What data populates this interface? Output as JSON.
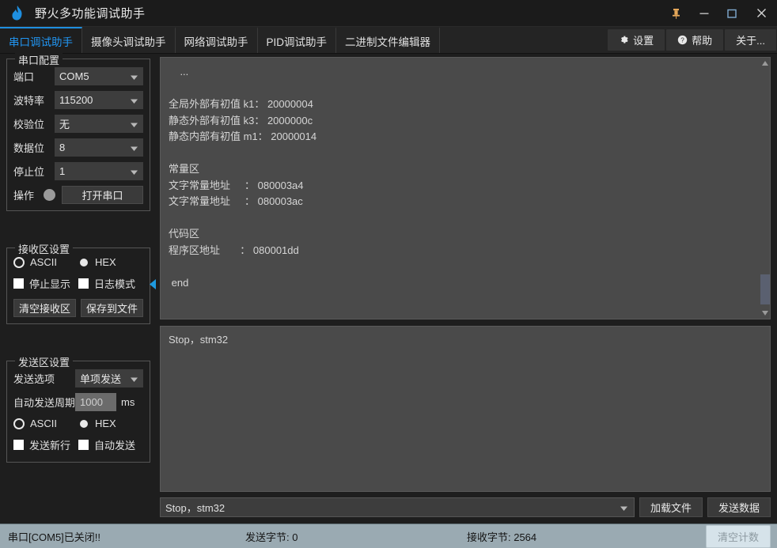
{
  "window": {
    "title": "野火多功能调试助手",
    "logo_icon": "flame-icon",
    "controls": [
      {
        "name": "pin",
        "icon": "pin-icon",
        "glyph": "⚑"
      },
      {
        "name": "minimize",
        "icon": "minimize-icon",
        "glyph": "—"
      },
      {
        "name": "maximize",
        "icon": "maximize-icon",
        "glyph": "☐"
      },
      {
        "name": "close",
        "icon": "close-icon",
        "glyph": "✕"
      }
    ]
  },
  "tabs": [
    {
      "label": "串口调试助手",
      "active": true
    },
    {
      "label": "摄像头调试助手",
      "active": false
    },
    {
      "label": "网络调试助手",
      "active": false
    },
    {
      "label": "PID调试助手",
      "active": false
    },
    {
      "label": "二进制文件编辑器",
      "active": false
    }
  ],
  "toolbar": {
    "settings_label": "设置",
    "settings_icon": "gear-icon",
    "help_label": "帮助",
    "help_icon": "question-circle-icon",
    "about_label": "关于..."
  },
  "serial_config": {
    "legend": "串口配置",
    "fields": [
      {
        "label": "端口",
        "value": "COM5"
      },
      {
        "label": "波特率",
        "value": "115200"
      },
      {
        "label": "校验位",
        "value": "无"
      },
      {
        "label": "数据位",
        "value": "8"
      },
      {
        "label": "停止位",
        "value": "1"
      }
    ],
    "action_label": "操作",
    "open_button": "打开串口",
    "led_color": "#9a9a9a"
  },
  "recv_settings": {
    "legend": "接收区设置",
    "radios": [
      {
        "label": "ASCII",
        "selected": true
      },
      {
        "label": "HEX",
        "selected": false
      }
    ],
    "checks": [
      {
        "label": "停止显示",
        "checked": false
      },
      {
        "label": "日志模式",
        "checked": false
      }
    ],
    "clear_button": "清空接收区",
    "save_button": "保存到文件"
  },
  "send_settings": {
    "legend": "发送区设置",
    "option_label": "发送选项",
    "option_value": "单项发送",
    "period_label": "自动发送周期",
    "period_value": "1000",
    "period_unit": "ms",
    "radios": [
      {
        "label": "ASCII",
        "selected": true
      },
      {
        "label": "HEX",
        "selected": false
      }
    ],
    "checks": [
      {
        "label": "发送新行",
        "checked": false
      },
      {
        "label": "自动发送",
        "checked": false
      }
    ]
  },
  "receive_area": {
    "text": "    ...\n\n全局外部有初值 k1： 20000004\n静态外部有初值 k3： 2000000c\n静态内部有初值 m1： 20000014\n\n常量区\n文字常量地址     ： 080003a4\n文字常量地址     ： 080003ac\n\n代码区\n程序区地址       ： 080001dd\n\n end",
    "scroll_up_icon": "triangle-up-icon",
    "scroll_down_icon": "triangle-down-icon"
  },
  "send_area": {
    "text": "Stop，stm32"
  },
  "send_bar": {
    "input_value": "Stop，stm32",
    "caret_icon": "chevron-down-icon",
    "load_file_button": "加载文件",
    "send_data_button": "发送数据"
  },
  "statusbar": {
    "connection": "串口[COM5]已关闭!!",
    "sent_bytes": "发送字节: 0",
    "received_bytes": "接收字节: 2564",
    "clear_count_button": "清空计数"
  },
  "colors": {
    "accent": "#2196f3",
    "window_bg": "#1e1e1e",
    "textarea_bg": "#4a4a4a",
    "statusbar_bg": "#9aaab2"
  }
}
